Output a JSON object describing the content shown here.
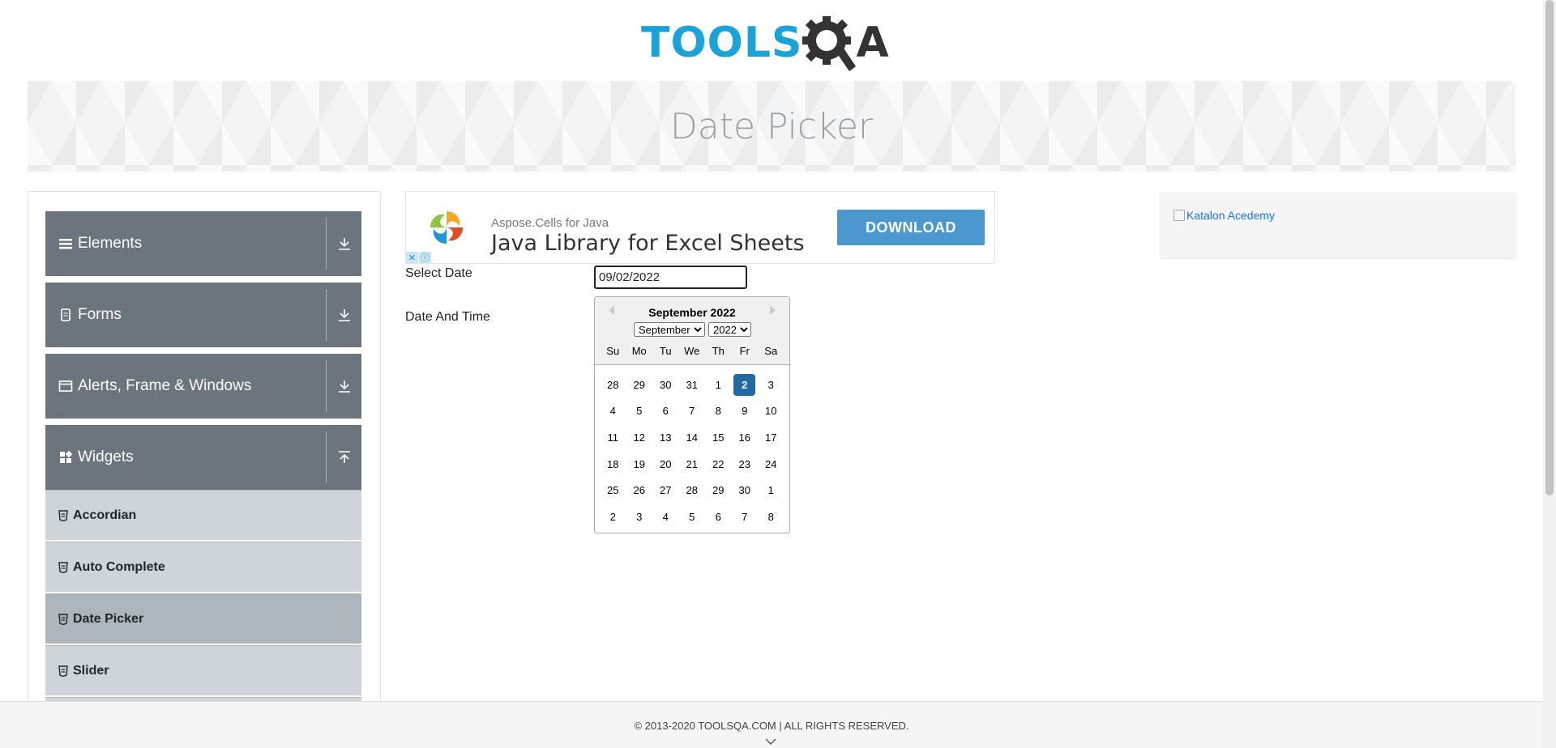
{
  "logo": {
    "part1": "TOOLS",
    "part2": "A"
  },
  "banner": {
    "title": "Date Picker"
  },
  "sidebar": {
    "groups": [
      {
        "label": "Elements"
      },
      {
        "label": "Forms"
      },
      {
        "label": "Alerts, Frame & Windows"
      },
      {
        "label": "Widgets"
      }
    ],
    "items": [
      {
        "label": "Accordian"
      },
      {
        "label": "Auto Complete"
      },
      {
        "label": "Date Picker"
      },
      {
        "label": "Slider"
      }
    ]
  },
  "ad": {
    "subtitle": "Aspose.Cells for Java",
    "title": "Java Library for Excel Sheets",
    "button": "DOWNLOAD"
  },
  "form": {
    "select_date_label": "Select Date",
    "date_time_label": "Date And Time",
    "date_value": "09/02/2022"
  },
  "calendar": {
    "header": "September 2022",
    "month_select": "September",
    "year_select": "2022",
    "weekdays": [
      "Su",
      "Mo",
      "Tu",
      "We",
      "Th",
      "Fr",
      "Sa"
    ],
    "weeks": [
      [
        "28",
        "29",
        "30",
        "31",
        "1",
        "2",
        "3"
      ],
      [
        "4",
        "5",
        "6",
        "7",
        "8",
        "9",
        "10"
      ],
      [
        "11",
        "12",
        "13",
        "14",
        "15",
        "16",
        "17"
      ],
      [
        "18",
        "19",
        "20",
        "21",
        "22",
        "23",
        "24"
      ],
      [
        "25",
        "26",
        "27",
        "28",
        "29",
        "30",
        "1"
      ],
      [
        "2",
        "3",
        "4",
        "5",
        "6",
        "7",
        "8"
      ]
    ],
    "selected_day": "2"
  },
  "right_ad": {
    "alt": "Katalon Acedemy"
  },
  "footer": {
    "text": "© 2013-2020 TOOLSQA.COM | ALL RIGHTS RESERVED."
  },
  "colors": {
    "accent": "#216ba5",
    "sidebar_header": "#6c757d",
    "logo_blue": "#1aa3d9"
  }
}
